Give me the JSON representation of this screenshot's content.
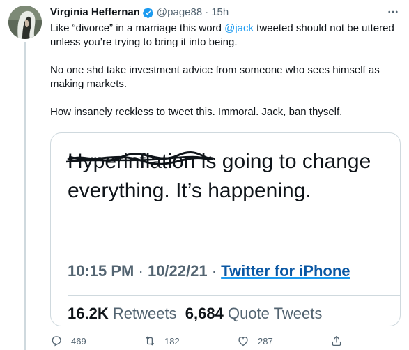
{
  "tweet": {
    "author_name": "Virginia Heffernan",
    "handle": "@page88",
    "separator": "·",
    "time": "15h",
    "body": {
      "p1_before": "Like “divorce” in a marriage this word ",
      "p1_mention": "@jack",
      "p1_after": " tweeted should not be uttered unless you’re trying to bring it into being.",
      "p2": "No one shd take investment advice from someone who sees himself as making markets.",
      "p3": "How insanely reckless to tweet this. Immoral. Jack, ban thyself."
    },
    "embedded": {
      "struck_word": "Hyperinflation",
      "text_rest": " is going to change everything. It’s happening.",
      "time": "10:15 PM",
      "meta_sep1": " · ",
      "date": "10/22/21",
      "meta_sep2": " · ",
      "source": "Twitter for iPhone",
      "retweets_count": "16.2K",
      "retweets_label": "Retweets",
      "quotes_count": "6,684",
      "quotes_label": "Quote Tweets"
    },
    "actions": {
      "replies": "469",
      "retweets": "182",
      "likes": "287"
    },
    "icons": {
      "verified": "verified-badge-icon",
      "more": "more-icon",
      "reply": "reply-icon",
      "retweet": "retweet-icon",
      "like": "heart-icon",
      "share": "share-icon"
    },
    "colors": {
      "accent": "#1d9bf0",
      "secondary_text": "#536471",
      "border": "#cfd9de"
    }
  }
}
